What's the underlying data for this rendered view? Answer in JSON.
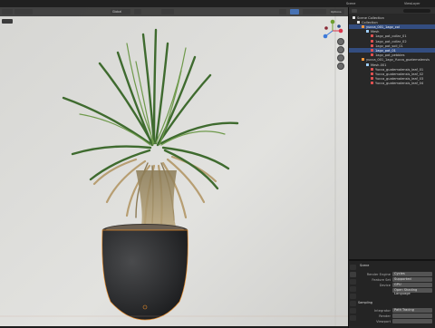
{
  "topbar": {
    "menu_label": "Scene",
    "view_layer_label": "ViewLayer"
  },
  "viewport": {
    "header_mode": "Global",
    "options_label": "Options"
  },
  "outliner": {
    "rows": [
      {
        "label": "Scene Collection",
        "depth": 0,
        "icon": "collection-icon",
        "color": "#e6e6e6",
        "selected": false
      },
      {
        "label": "Collection",
        "depth": 1,
        "icon": "collection-icon",
        "color": "#e6e6e6",
        "selected": false
      },
      {
        "label": "yucca_001_1agv_col",
        "depth": 2,
        "icon": "object-icon",
        "color": "#ff9a3c",
        "selected": true
      },
      {
        "label": "Mesh",
        "depth": 3,
        "icon": "mesh-icon",
        "color": "#9fd0ff",
        "selected": false
      },
      {
        "label": "1agv_pot_collar_01",
        "depth": 4,
        "icon": "material-icon",
        "color": "#e05050",
        "selected": false
      },
      {
        "label": "1agv_pot_collar_02",
        "depth": 4,
        "icon": "material-icon",
        "color": "#e05050",
        "selected": false
      },
      {
        "label": "1agv_pot_soil_01",
        "depth": 4,
        "icon": "material-icon",
        "color": "#e05050",
        "selected": false
      },
      {
        "label": "1agv_pot_01",
        "depth": 4,
        "icon": "material-icon",
        "color": "#e05050",
        "selected": true
      },
      {
        "label": "1agv_pot_pebbles",
        "depth": 4,
        "icon": "material-icon",
        "color": "#e05050",
        "selected": false
      },
      {
        "label": "yucca_001_1agv_Yucca_guatemalensis",
        "depth": 2,
        "icon": "object-icon",
        "color": "#ff9a3c",
        "selected": false
      },
      {
        "label": "Mesh.001",
        "depth": 3,
        "icon": "mesh-icon",
        "color": "#9fd0ff",
        "selected": false
      },
      {
        "label": "Yucca_guatemalensis_leaf_01",
        "depth": 4,
        "icon": "material-icon",
        "color": "#e05050",
        "selected": false
      },
      {
        "label": "Yucca_guatemalensis_leaf_02",
        "depth": 4,
        "icon": "material-icon",
        "color": "#e05050",
        "selected": false
      },
      {
        "label": "Yucca_guatemalensis_leaf_03",
        "depth": 4,
        "icon": "material-icon",
        "color": "#e05050",
        "selected": false
      },
      {
        "label": "Yucca_guatemalensis_leaf_04",
        "depth": 4,
        "icon": "material-icon",
        "color": "#e05050",
        "selected": false
      }
    ]
  },
  "properties": {
    "section_title": "Scene",
    "rows": [
      {
        "key": "Render Engine",
        "value": "Cycles"
      },
      {
        "key": "Feature Set",
        "value": "Supported"
      },
      {
        "key": "Device",
        "value": "GPU"
      },
      {
        "key": "",
        "value": "Open Shading Language"
      }
    ],
    "sampling_label": "Sampling",
    "sampling_rows": [
      {
        "key": "Integrator",
        "value": "Path Tracing"
      },
      {
        "key": "Render",
        "value": ""
      },
      {
        "key": "Viewport",
        "value": ""
      }
    ]
  }
}
